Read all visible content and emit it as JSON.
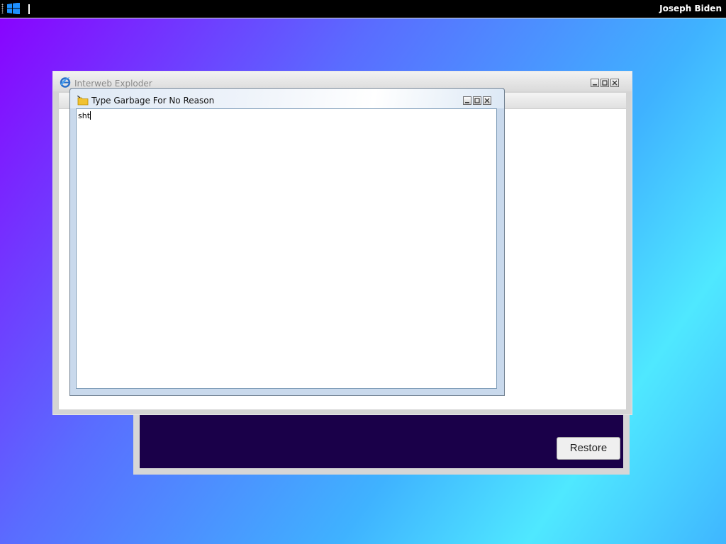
{
  "taskbar": {
    "username": "Joseph Biden",
    "start_icon": "windows-logo-icon"
  },
  "browser": {
    "title": "Interweb Exploder",
    "icon": "ie-logo-icon"
  },
  "editor": {
    "title": "Type Garbage For No Reason",
    "icon": "folder-icon",
    "text": "sht"
  },
  "restore_panel": {
    "restore_label": "Restore",
    "background_color": "#1a0049"
  },
  "window_controls": [
    "minimize",
    "maximize",
    "close"
  ]
}
